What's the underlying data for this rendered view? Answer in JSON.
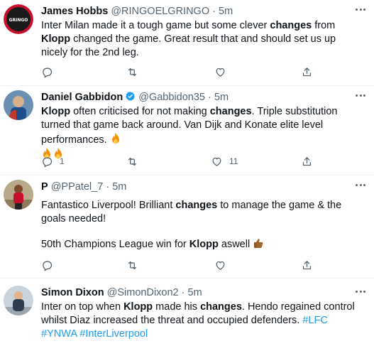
{
  "tweets": [
    {
      "name": "James Hobbs",
      "handle": "@RINGOELGRINGO",
      "separator": "·",
      "time": "5m",
      "avatar_text": "GRINGO",
      "text": [
        "Inter Milan made it a tough game but some clever ",
        "changes",
        " from ",
        "Klopp",
        " changed the game. Great result that and should set us up nicely for the 2nd leg."
      ],
      "reply_count": "",
      "like_count": ""
    },
    {
      "name": "Daniel Gabbidon",
      "handle": "@Gabbidon35",
      "separator": "·",
      "time": "5m",
      "text": [
        "Klopp",
        " often criticised for not making ",
        "changes",
        ". Triple substitution turned that game back around. Van Dijk and Konate elite level performances. "
      ],
      "reply_count": "1",
      "like_count": "11"
    },
    {
      "name": "P",
      "handle": "@PPatel_7",
      "separator": "·",
      "time": "5m",
      "text_line1_parts": [
        "Fantastico Liverpool! Brilliant ",
        "changes",
        " to manage the game & the goals needed!"
      ],
      "text_line2_parts": [
        "50th Champions League win for ",
        "Klopp",
        " aswell "
      ],
      "reply_count": "",
      "like_count": ""
    },
    {
      "name": "Simon Dixon",
      "handle": "@SimonDixon2",
      "separator": "·",
      "time": "5m",
      "text": [
        "Inter on top when ",
        "Klopp",
        " made his ",
        "changes",
        ". Hendo regained control whilst Diaz increased the threat and occupied defenders. "
      ],
      "hashtags": [
        "#LFC",
        "#YNWA",
        "#InterLiverpool"
      ]
    }
  ],
  "colors": {
    "text": "#0f1419",
    "secondary": "#536471",
    "link": "#1d9bf0",
    "divider": "#eff3f4"
  },
  "icons": [
    "reply-icon",
    "retweet-icon",
    "like-icon",
    "share-icon",
    "more-icon",
    "verified-badge-icon",
    "fire-emoji",
    "thumbs-up-emoji"
  ]
}
